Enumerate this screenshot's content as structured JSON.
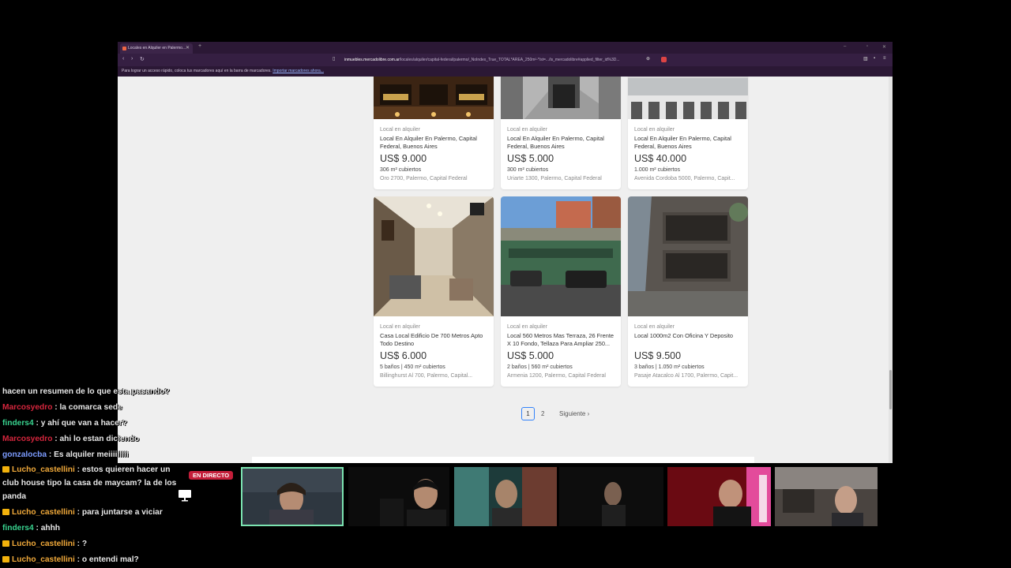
{
  "browser": {
    "tab_title": "Locales en Alquiler en Palermo...",
    "url_host": "inmuebles.mercadolibre.com.ar",
    "url_rest": "/locales/alquiler/capital-federal/palermo/_NoIndex_True_TOTAL*AREA_250m²-*/st=.../is_mercadolibre#applied_filter_id%3D...",
    "bookmarks_text": "Para lograr un acceso rápido, coloca tus marcadores aquí en la barra de marcadores.",
    "bookmarks_link": "Importar marcadores ahora..."
  },
  "listings_top": [
    {
      "kind": "Local en alquiler",
      "title": "Local En Alquiler En Palermo, Capital Federal, Buenos Aires",
      "price": "US$ 9.000",
      "features": "306 m² cubiertos",
      "address": "Oro 2700, Palermo, Capital Federal"
    },
    {
      "kind": "Local en alquiler",
      "title": "Local En Alquiler En Palermo, Capital Federal, Buenos Aires",
      "price": "US$ 5.000",
      "features": "300 m² cubiertos",
      "address": "Uriarte 1300, Palermo, Capital Federal"
    },
    {
      "kind": "Local en alquiler",
      "title": "Local En Alquiler En Palermo, Capital Federal, Buenos Aires",
      "price": "US$ 40.000",
      "features": "1.000 m² cubiertos",
      "address": "Avenida Cordoba 5000, Palermo, Capit..."
    }
  ],
  "listings_bottom": [
    {
      "kind": "Local en alquiler",
      "title": "Casa Local Edificio De 700 Metros Apto Todo Destino",
      "price": "US$ 6.000",
      "features": "5 baños | 450 m² cubiertos",
      "address": "Billinghurst Al 700, Palermo, Capital..."
    },
    {
      "kind": "Local en alquiler",
      "title": "Local 560 Metros Mas Terraza, 26 Frente X 10 Fondo, Tellaza Para Ampliar 250...",
      "price": "US$ 5.000",
      "features": "2 baños | 560 m² cubiertos",
      "address": "Armenia 1200, Palermo, Capital Federal"
    },
    {
      "kind": "Local en alquiler",
      "title": "Local 1000m2 Con Oficina Y Deposito",
      "price": "US$ 9.500",
      "features": "3 baños | 1.050 m² cubiertos",
      "address": "Pasaje Atacalco Al 1700, Palermo, Capit..."
    }
  ],
  "pagination": {
    "current": "1",
    "next_page": "2",
    "next_label": "Siguiente"
  },
  "chat": [
    {
      "user": "",
      "text": "hacen un resumen de lo que esta pasando?",
      "color": "#e6e6e6"
    },
    {
      "user": "Marcosyedro",
      "text": " : la comarca sede",
      "color": "#d5263d"
    },
    {
      "user": "finders4",
      "text": " : y ahí que van a hacer?",
      "color": "#38d38f"
    },
    {
      "user": "Marcosyedro",
      "text": " : ahi lo estan diciendo",
      "color": "#d5263d"
    },
    {
      "user": "gonzalocba",
      "text": " : Es alquiler meiiiiiiiii",
      "color": "#7c9cff"
    },
    {
      "user": "Lucho_castellini",
      "text": " : estos quieren hacer un club house tipo la casa de maycam? la de los panda",
      "color": "#f0a93a",
      "badge": true
    },
    {
      "user": "Lucho_castellini",
      "text": " : para juntarse a viciar",
      "color": "#f0a93a",
      "badge": true
    },
    {
      "user": "finders4",
      "text": " : ahhh",
      "color": "#38d38f"
    },
    {
      "user": "Lucho_castellini",
      "text": " : ?",
      "color": "#f0a93a",
      "badge": true
    },
    {
      "user": "Lucho_castellini",
      "text": " : o entendi mal?",
      "color": "#f0a93a",
      "badge": true
    }
  ],
  "stream": {
    "live_label": "EN DIRECTO"
  }
}
